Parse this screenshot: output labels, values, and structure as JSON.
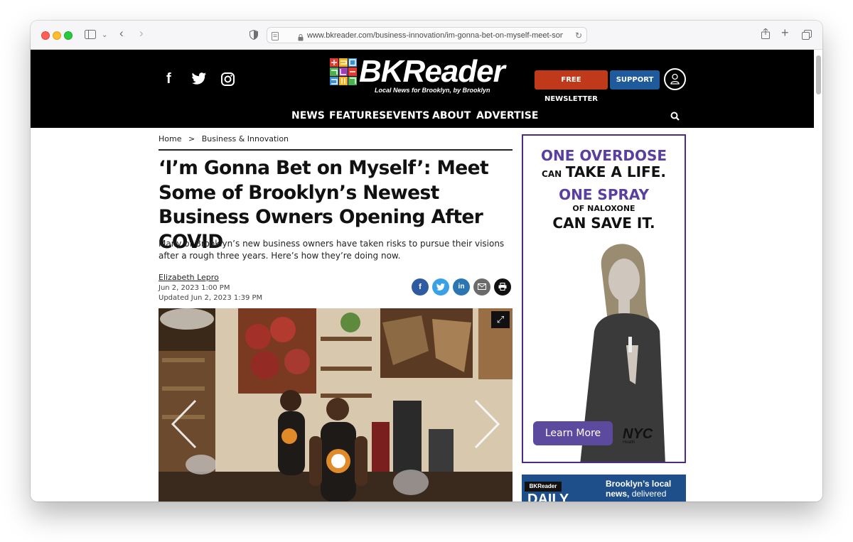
{
  "browser": {
    "url": "www.bkreader.com/business-innovation/im-gonna-bet-on-myself-meet-some-"
  },
  "site": {
    "logo_text": "BKReader",
    "tagline": "Local News for Brooklyn, by Brooklyn",
    "newsletter_label": "FREE NEWSLETTER",
    "support_label": "SUPPORT",
    "nav": [
      "NEWS",
      "FEATURES",
      "EVENTS",
      "ABOUT",
      "ADVERTISE"
    ]
  },
  "article": {
    "breadcrumb_home": "Home",
    "breadcrumb_sep": ">",
    "breadcrumb_section": "Business & Innovation",
    "headline": "‘I’m Gonna Bet on Myself’: Meet Some of Brooklyn’s Newest Business Owners Opening After COVID",
    "dek": "Many of Brooklyn’s new business owners have taken risks to pursue their visions after a rough three years. Here’s how they’re doing now.",
    "author": "Elizabeth Lepro",
    "date": "Jun 2, 2023 1:00 PM",
    "updated": "Updated Jun 2, 2023 1:39 PM"
  },
  "ad": {
    "line1": "ONE OVERDOSE",
    "line2a": "CAN",
    "line2b": "TAKE A LIFE.",
    "line3": "ONE SPRAY",
    "line4": "OF NALOXONE",
    "line5": "CAN SAVE IT.",
    "cta": "Learn More",
    "sponsor": "NYC",
    "sponsor_sub": "Health"
  },
  "ad2": {
    "badge": "BKReader",
    "badge_sub": "DAILY",
    "text_a": "Brooklyn’s local news,",
    "text_b": "delivered"
  },
  "colors": {
    "newsletter": "#c0391b",
    "support": "#1e5a9c",
    "ad_border": "#4b2a8a",
    "ad_purple": "#5b4a9e"
  }
}
